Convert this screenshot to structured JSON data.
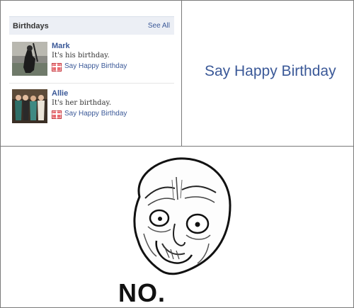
{
  "widget": {
    "title": "Birthdays",
    "see_all": "See All",
    "entries": [
      {
        "name": "Mark",
        "status": "It's his birthday.",
        "action": "Say Happy Birthday"
      },
      {
        "name": "Allie",
        "status": "It's her birthday.",
        "action": "Say Happy Birthday"
      }
    ]
  },
  "zoom": {
    "label": "Say Happy Birthday"
  },
  "reaction": {
    "caption": "NO."
  },
  "colors": {
    "link": "#3b5998",
    "header_bg": "#eceff5",
    "gift": "#c4333a"
  },
  "icons": [
    "gift-icon",
    "rage-face"
  ]
}
